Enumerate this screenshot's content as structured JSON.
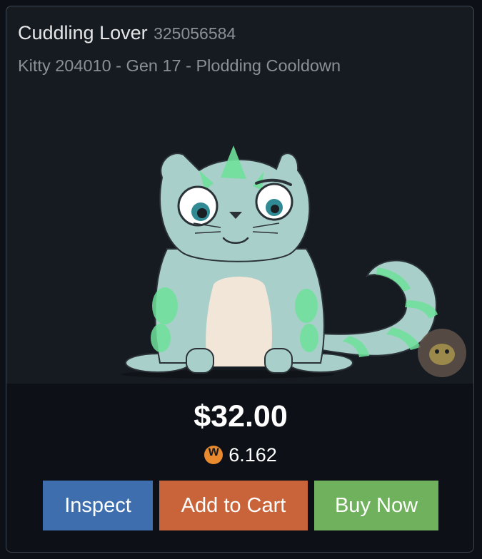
{
  "listing": {
    "name": "Cuddling Lover",
    "token_id": "325056584",
    "subtitle": "Kitty 204010 - Gen 17 - Plodding Cooldown",
    "price_usd": "$32.00",
    "price_token": "6.162",
    "token_icon": "wax-token-icon"
  },
  "actions": {
    "inspect_label": "Inspect",
    "cart_label": "Add to Cart",
    "buy_label": "Buy Now"
  },
  "colors": {
    "card_bg": "#161b22",
    "bottom_bg": "#0d1117",
    "inspect": "#3e6eae",
    "cart": "#c9643a",
    "buy": "#6fb15c",
    "token": "#e98a2f"
  }
}
